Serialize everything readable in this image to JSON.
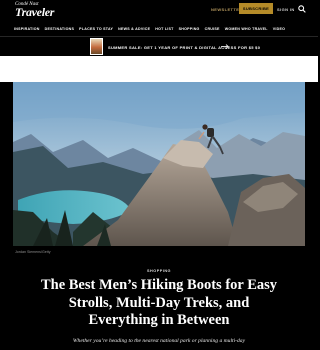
{
  "header": {
    "logo_small": "Condé Nast",
    "logo_main": "Traveler",
    "newsletter_label": "NEWSLETTER",
    "subscribe_label": "SUBSCRIBE",
    "signin_label": "SIGN IN",
    "search_icon": "search-icon",
    "accent_color": "#b58b28"
  },
  "nav": {
    "items": [
      {
        "label": "INSPIRATION"
      },
      {
        "label": "DESTINATIONS"
      },
      {
        "label": "PLACES TO STAY"
      },
      {
        "label": "NEWS & ADVICE"
      },
      {
        "label": "HOT LIST"
      },
      {
        "label": "SHOPPING"
      },
      {
        "label": "CRUISE"
      },
      {
        "label": "WOMEN WHO TRAVEL"
      },
      {
        "label": "VIDEO"
      }
    ]
  },
  "promo": {
    "text": "SUMMER SALE: GET 1 YEAR OF PRINT & DIGITAL ACCESS FOR $5 $0",
    "arrow_icon": "arrow-right-icon"
  },
  "hero": {
    "photo_credit": "Jordan Siemens/Getty"
  },
  "article": {
    "category": "SHOPPING",
    "headline": "The Best Men’s Hiking Boots for Easy Strolls, Multi-Day Treks, and Everything in Between",
    "dek": "Whether you’re heading to the nearest national park or planning a multi-day"
  }
}
